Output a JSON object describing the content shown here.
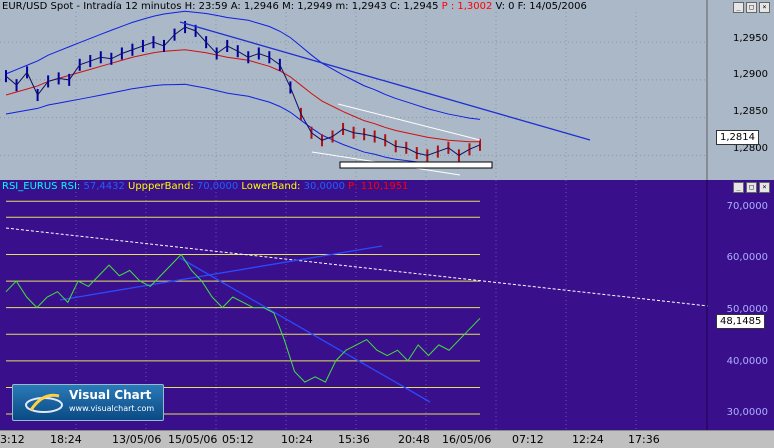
{
  "price_pane": {
    "title_segments": [
      {
        "text": "EUR/USD Spot - Intradía 12 minutos",
        "color": "#000000"
      },
      {
        "text": "H: 23:59",
        "color": "#000000"
      },
      {
        "text": "A: 1,2946",
        "color": "#000000"
      },
      {
        "text": "M: 1,2949",
        "color": "#000000"
      },
      {
        "text": "m: 1,2943",
        "color": "#000000"
      },
      {
        "text": "C: 1,2945",
        "color": "#000000"
      },
      {
        "text": "P : 1,3002",
        "color": "#ff0000"
      },
      {
        "text": "V: 0",
        "color": "#000000"
      },
      {
        "text": "F: 14/05/2006",
        "color": "#000000"
      }
    ],
    "y_ticks": [
      "1,2950",
      "1,2900",
      "1,2850",
      "1,2800"
    ],
    "current_value": "1,2814",
    "window_buttons": [
      "_",
      "□",
      "×"
    ]
  },
  "rsi_pane": {
    "title_segments": [
      {
        "text": "RSI_EURUS",
        "color": "#00ffff"
      },
      {
        "text": "RSI:",
        "color": "#00ffff"
      },
      {
        "text": "57,4432",
        "color": "#2060ff"
      },
      {
        "text": "UppperBand:",
        "color": "#ffff00"
      },
      {
        "text": "70,0000",
        "color": "#2060ff"
      },
      {
        "text": "LowerBand:",
        "color": "#ffff00"
      },
      {
        "text": "30,0000",
        "color": "#2060ff"
      },
      {
        "text": "P: 110,1951",
        "color": "#ff0000"
      }
    ],
    "y_ticks": [
      "70,0000",
      "60,0000",
      "50,0000",
      "40,0000",
      "30,0000"
    ],
    "current_value": "48,1485",
    "window_buttons": [
      "_",
      "□",
      "×"
    ]
  },
  "time_axis": [
    "3:12",
    "18:24",
    "13/05/06",
    "15/05/06",
    "05:12",
    "10:24",
    "15:36",
    "20:48",
    "16/05/06",
    "07:12",
    "12:24",
    "17:36"
  ],
  "logo": {
    "brand": "Visual Chart",
    "url": "www.visualchart.com"
  },
  "colors": {
    "price_bg": "#aab8c8",
    "rsi_bg": "#3a0f8c",
    "price_series": "#0000a0",
    "band": "#1020e0",
    "moving_avg": "#d01010",
    "trendline": "#2030d0",
    "rsi_series": "#40e040",
    "band_lines": "#e0e060"
  },
  "chart_data": [
    {
      "type": "line",
      "title": "EUR/USD Spot - Intradía 12 minutos",
      "ylim": [
        1.277,
        1.299
      ],
      "y_ticks": [
        1.295,
        1.29,
        1.285,
        1.28
      ],
      "series": [
        {
          "values": [
            1.2905,
            1.2893,
            1.291,
            1.288,
            1.2898,
            1.2902,
            1.29,
            1.292,
            1.2925,
            1.293,
            1.2928,
            1.2935,
            1.294,
            1.2945,
            1.295,
            1.2945,
            1.296,
            1.297,
            1.2965,
            1.295,
            1.2935,
            1.2945,
            1.2938,
            1.293,
            1.2935,
            1.293,
            1.292,
            1.289,
            1.2855,
            1.283,
            1.282,
            1.2825,
            1.2835,
            1.283,
            1.2828,
            1.2825,
            1.282,
            1.2812,
            1.281,
            1.2803,
            1.28,
            1.2805,
            1.281,
            1.28,
            1.2808,
            1.2814
          ]
        },
        {
          "values": [
            1.288,
            1.2884,
            1.2888,
            1.2892,
            1.2898,
            1.2902,
            1.2906,
            1.291,
            1.2914,
            1.2918,
            1.2922,
            1.2926,
            1.293,
            1.2933,
            1.2936,
            1.2938,
            1.2939,
            1.294,
            1.2938,
            1.2936,
            1.2933,
            1.293,
            1.2928,
            1.2926,
            1.2922,
            1.2918,
            1.2912,
            1.2904,
            1.2893,
            1.2882,
            1.2872,
            1.2865,
            1.2858,
            1.2852,
            1.2846,
            1.2842,
            1.2837,
            1.2833,
            1.283,
            1.2827,
            1.2824,
            1.2822,
            1.282,
            1.2819,
            1.2818,
            1.2818
          ]
        }
      ]
    },
    {
      "type": "line",
      "title": "RSI_EURUS",
      "ylim": [
        27,
        74
      ],
      "y_ticks": [
        70,
        60,
        50,
        40,
        30
      ],
      "bands": [
        70,
        67,
        60,
        55,
        50,
        45,
        40,
        35,
        30
      ],
      "series": [
        {
          "values": [
            53,
            55,
            52,
            50,
            52,
            53,
            51,
            55,
            54,
            56,
            58,
            56,
            57,
            55,
            54,
            56,
            58,
            60,
            57,
            55,
            52,
            50,
            52,
            51,
            50,
            50,
            49,
            44,
            38,
            36,
            37,
            36,
            40,
            42,
            43,
            44,
            42,
            41,
            42,
            40,
            43,
            41,
            43,
            42,
            44,
            46,
            48
          ]
        }
      ]
    }
  ]
}
